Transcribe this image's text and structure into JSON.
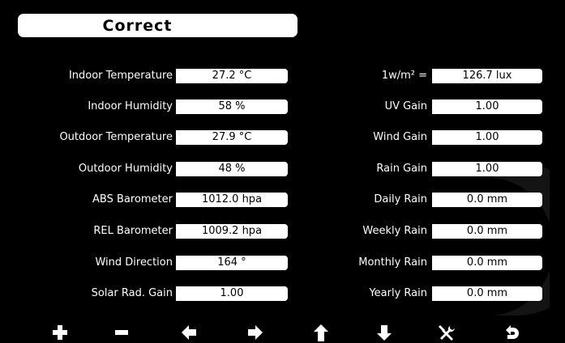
{
  "header": {
    "title": "Correct"
  },
  "left_fields": [
    {
      "label": "Indoor Temperature",
      "value": "27.2 °C"
    },
    {
      "label": "Indoor Humidity",
      "value": "58 %"
    },
    {
      "label": "Outdoor Temperature",
      "value": "27.9 °C"
    },
    {
      "label": "Outdoor Humidity",
      "value": "48 %"
    },
    {
      "label": "ABS Barometer",
      "value": "1012.0 hpa"
    },
    {
      "label": "REL Barometer",
      "value": "1009.2 hpa"
    },
    {
      "label": "Wind Direction",
      "value": "164 °"
    },
    {
      "label": "Solar Rad. Gain",
      "value": "1.00"
    }
  ],
  "right_fields": [
    {
      "label": "1w/m² =",
      "value": "126.7 lux"
    },
    {
      "label": "UV Gain",
      "value": "1.00"
    },
    {
      "label": "Wind Gain",
      "value": "1.00"
    },
    {
      "label": "Rain Gain",
      "value": "1.00"
    },
    {
      "label": "Daily Rain",
      "value": "0.0 mm"
    },
    {
      "label": "Weekly Rain",
      "value": "0.0 mm"
    },
    {
      "label": "Monthly Rain",
      "value": "0.0 mm"
    },
    {
      "label": "Yearly Rain",
      "value": "0.0 mm"
    }
  ],
  "toolbar": [
    {
      "icon": "plus-icon"
    },
    {
      "icon": "minus-icon"
    },
    {
      "icon": "arrow-left-icon"
    },
    {
      "icon": "arrow-right-icon"
    },
    {
      "icon": "arrow-up-icon"
    },
    {
      "icon": "arrow-down-icon"
    },
    {
      "icon": "tools-icon"
    },
    {
      "icon": "return-icon"
    }
  ],
  "colors": {
    "background": "#000000",
    "field": "#ffffff",
    "text": "#ffffff"
  }
}
